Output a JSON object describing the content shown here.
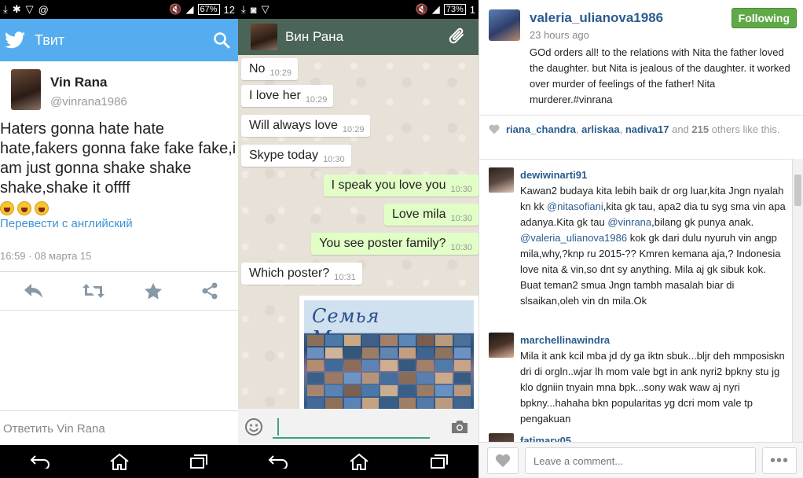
{
  "twitter": {
    "status": {
      "left_icons": "download/gear/vpn/at icons",
      "battery": "67%",
      "time": "12"
    },
    "header_title": "Твит",
    "author_name": "Vin Rana",
    "author_handle": "@vinrana1986",
    "tweet_text": "Haters gonna hate hate hate,fakers gonna fake fake fake,i am just gonna shake shake shake,shake it offff",
    "translate_link": "Перевести с английский",
    "timestamp": "16:59 · 08 марта 15",
    "reply_placeholder": "Ответить Vin Rana"
  },
  "whatsapp": {
    "status": {
      "battery": "73%",
      "time": "1"
    },
    "contact_name": "Вин Рана",
    "messages": [
      {
        "dir": "in",
        "text": "No",
        "time": "10:29"
      },
      {
        "dir": "in",
        "text": "I love her",
        "time": "10:29"
      },
      {
        "dir": "in",
        "text": "Will always love",
        "time": "10:29"
      },
      {
        "dir": "in",
        "text": "Skype today",
        "time": "10:30"
      },
      {
        "dir": "out",
        "text": "I speak you love you",
        "time": "10:30"
      },
      {
        "dir": "out",
        "text": "Love mila",
        "time": "10:30"
      },
      {
        "dir": "out",
        "text": "You see poster family?",
        "time": "10:30"
      },
      {
        "dir": "in",
        "text": "Which poster?",
        "time": "10:31"
      }
    ],
    "photo_title": "Семья Миланы"
  },
  "instagram": {
    "username": "valeria_ulianova1986",
    "time_ago": "23 hours ago",
    "follow_label": "Following",
    "caption": "GOd orders all! to the relations with Nita the father loved the daughter. but Nita is jealous of the daughter. it worked over murder of feelings of the father! Nita murderer.#vinrana",
    "likes": {
      "user1": "riana_chandra",
      "sep1": ",",
      "user2": "arliskaa",
      "sep2": ",",
      "user3": "nadiva17",
      "and": "and",
      "count": "215",
      "rest": "others like this."
    },
    "comments": [
      {
        "user": "dewiwinarti91",
        "parts": [
          {
            "t": "Kawan2 budaya kita lebih baik dr org luar,kita Jngn nyalah kn kk ",
            "m": false
          },
          {
            "t": "@nitasofiani",
            "m": true
          },
          {
            "t": ",kita gk tau, apa2 dia tu syg sma vin apa adanya.Kita gk tau ",
            "m": false
          },
          {
            "t": "@vinrana",
            "m": true
          },
          {
            "t": ",bilang gk punya anak. ",
            "m": false
          },
          {
            "t": "@valeria_ulianova1986",
            "m": true
          },
          {
            "t": " kok gk dari dulu nyuruh vin angp mila,why,?knp ru 2015-?? Kmren kemana aja,? Indonesia love nita & vin,so dnt sy anything. Mila aj gk sibuk kok. Buat teman2 smua Jngn tambh masalah biar di slsaikan,oleh vin dn mila.Ok",
            "m": false
          }
        ]
      },
      {
        "user": "marchellinawindra",
        "parts": [
          {
            "t": "Mila it ank kcil mba jd dy ga iktn sbuk...bljr deh mmposiskn dri di orgln..wjar lh mom vale bgt in ank nyri2 bpkny stu jg klo dgniin tnyain mna bpk...sony wak waw aj nyri bpkny...hahaha bkn popularitas yg dcri mom vale tp pengakuan",
            "m": false
          }
        ]
      },
      {
        "user": "fatimary05",
        "parts": []
      }
    ],
    "comment_placeholder": "Leave a comment...",
    "more_label": "•••"
  },
  "colors": {
    "twitter_blue": "#55acee",
    "whatsapp_header": "#4b6458",
    "whatsapp_out": "#e1fec6",
    "instagram_link": "#2a5d8f",
    "follow_green": "#5fa946"
  }
}
